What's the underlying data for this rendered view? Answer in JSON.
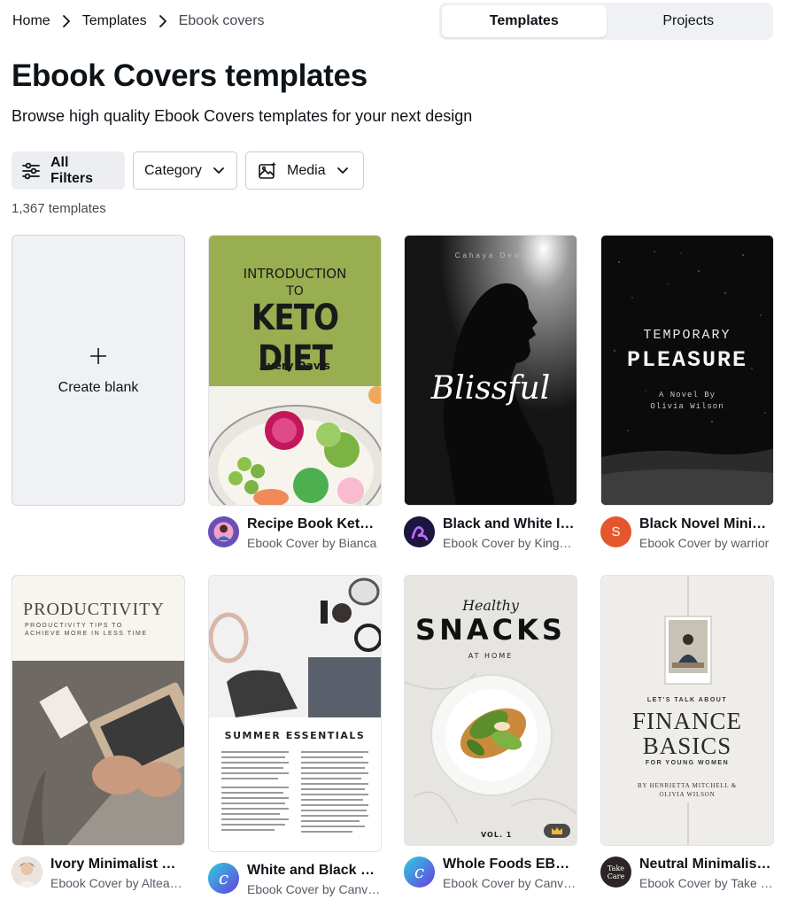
{
  "breadcrumb": {
    "items": [
      "Home",
      "Templates",
      "Ebook covers"
    ]
  },
  "toggle": {
    "options": [
      "Templates",
      "Projects"
    ],
    "active": "Templates"
  },
  "page": {
    "title": "Ebook Covers templates",
    "subtitle": "Browse high quality Ebook Covers templates for your next design",
    "count": "1,367 templates"
  },
  "filters": {
    "all": "All Filters",
    "category": "Category",
    "media": "Media"
  },
  "create_blank": {
    "label": "Create blank"
  },
  "templates": [
    {
      "title": "Recipe Book Keto Ebook Cover",
      "subtitle": "Ebook Cover by Bianca",
      "avatar_letter": "",
      "avatar_color": "#6b4fb5",
      "cover": {
        "l1": "INTRODUCTION",
        "l2": "TO",
        "l3": "KETO DIET",
        "l4": "Avery Davis"
      }
    },
    {
      "title": "Black and White Illustration Ebook Cover",
      "subtitle": "Ebook Cover by KingKreative",
      "avatar_letter": "",
      "avatar_color": "#1c1540",
      "cover": {
        "l1": "Cahaya Dewi",
        "l2": "Blissful"
      }
    },
    {
      "title": "Black Novel Minimalist Ebook Cover",
      "subtitle": "Ebook Cover by warrior",
      "avatar_letter": "S",
      "avatar_color": "#e4572e",
      "cover": {
        "l1": "TEMPORARY",
        "l2": "PLEASURE",
        "l3": "A Novel By",
        "l4": "Olivia Wilson"
      }
    },
    {
      "title": "Ivory Minimalist Clean Productivity Ebook Cover",
      "subtitle": "Ebook Cover by Altea Studio",
      "avatar_letter": "",
      "avatar_color": "#d9c9b8",
      "cover": {
        "l1": "PRODUCTIVITY",
        "l2": "PRODUCTIVITY TIPS TO ACHIEVE MORE IN LESS TIME"
      }
    },
    {
      "title": "White and Black Summer Essentials Ebook Cover",
      "subtitle": "Ebook Cover by Canva Creative Studio",
      "avatar_letter": "C",
      "avatar_color": "#3aa7e8",
      "cover": {
        "l1": "SUMMER ESSENTIALS"
      }
    },
    {
      "title": "Whole Foods EBook",
      "subtitle": "Ebook Cover by Canva Creative Studio",
      "avatar_letter": "C",
      "avatar_color": "#3aa7e8",
      "cover": {
        "l1": "Healthy",
        "l2": "SNACKS",
        "l3": "AT HOME",
        "l4": "VOL. 1"
      }
    },
    {
      "title": "Neutral Minimalist Finance Ebook Cover",
      "subtitle": "Ebook Cover by Take Care Creative",
      "avatar_letter": "Take Care",
      "avatar_color": "#2b2624",
      "cover": {
        "l1": "LET'S TALK ABOUT",
        "l2": "FINANCE BASICS",
        "l3": "FOR YOUNG WOMEN",
        "l4": "BY HENRIETTA MITCHELL & OLIVIA WILSON"
      }
    }
  ],
  "colors": {
    "keto_green": "#99ae50",
    "canva_blue": "#3aa7e8",
    "s_avatar": "#e4572e"
  },
  "icons": [
    "chevron-right-icon",
    "sliders-icon",
    "chevron-down-icon",
    "image-sparkle-icon",
    "plus-icon",
    "crown-icon"
  ]
}
